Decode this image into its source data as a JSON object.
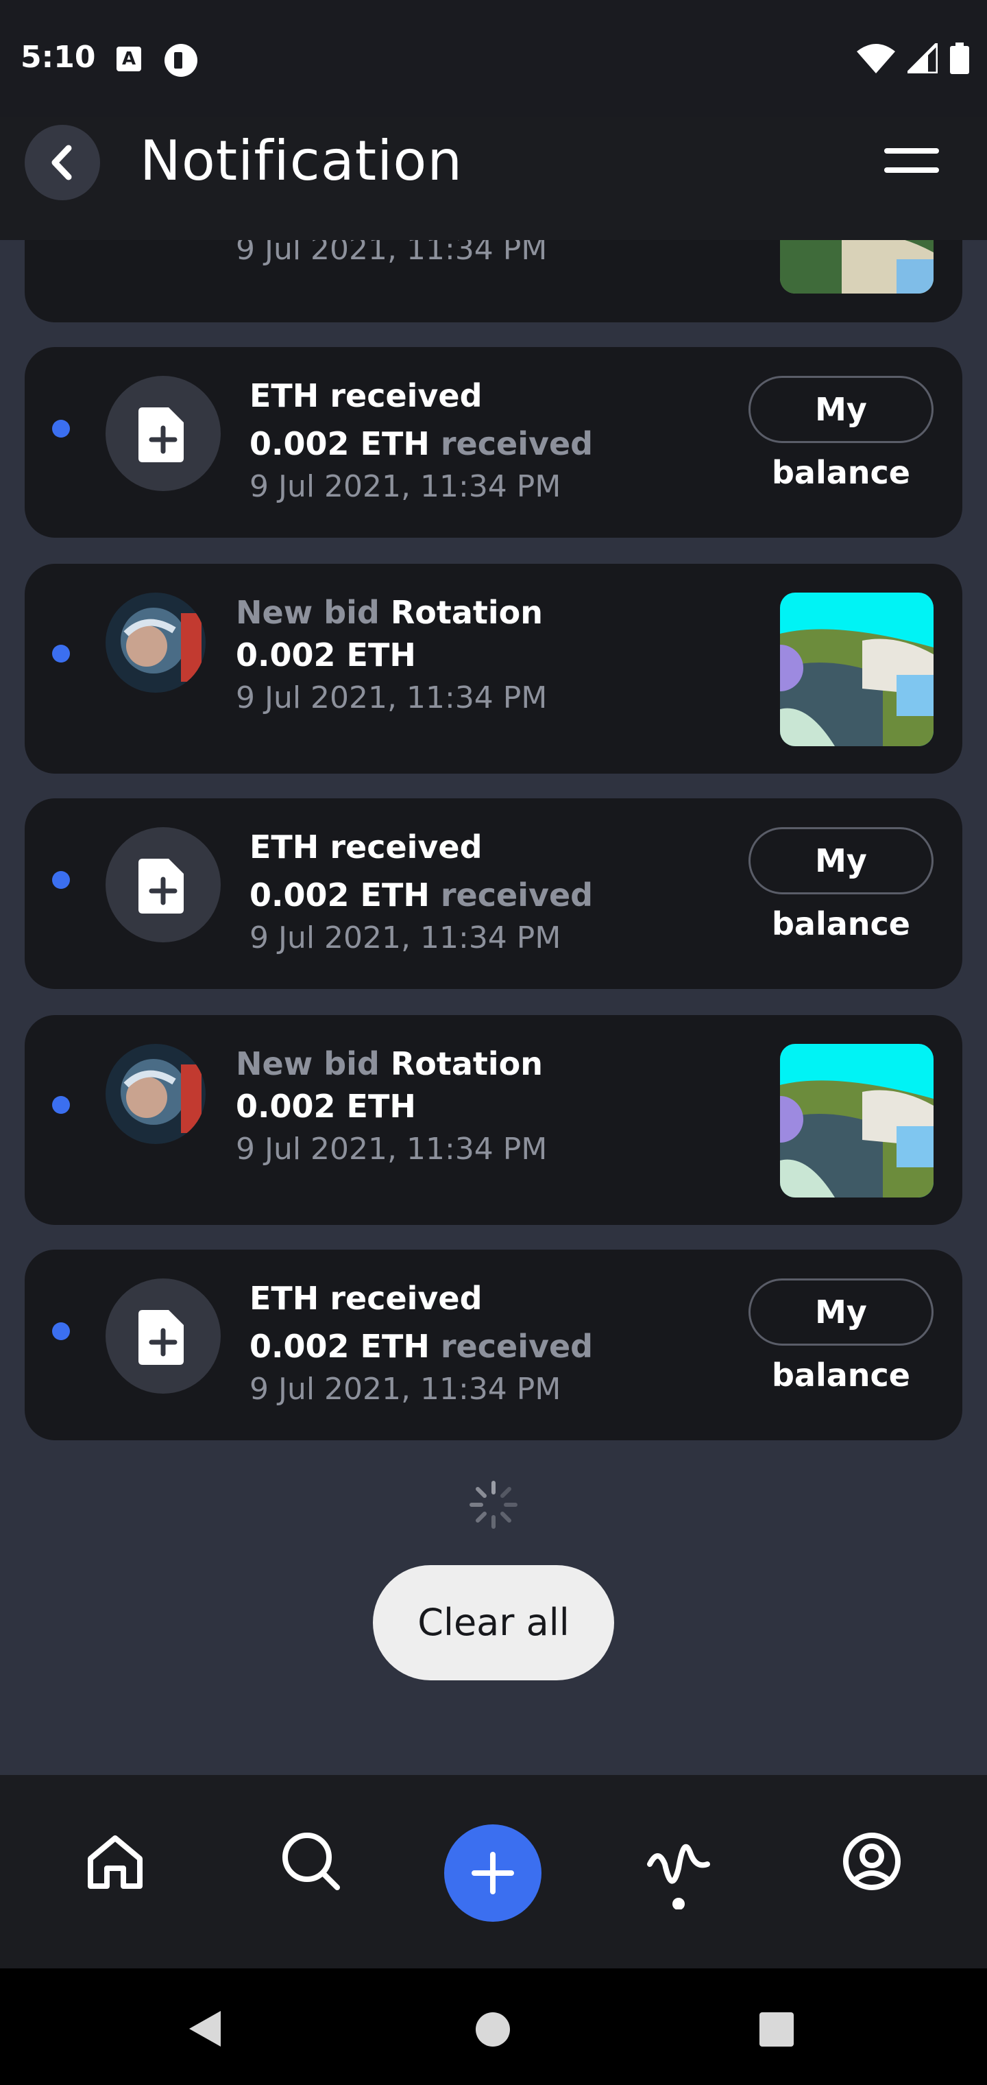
{
  "status": {
    "time": "5:10"
  },
  "header": {
    "title": "Notification"
  },
  "top_card": {
    "date": "9 Jul 2021, 11:34 PM"
  },
  "notifications": [
    {
      "type": "eth",
      "title": "ETH received",
      "amount": "0.002 ETH",
      "suffix": "received",
      "date": "9 Jul 2021, 11:34 PM",
      "action": "My balance"
    },
    {
      "type": "bid",
      "prefix": "New bid",
      "name": "Rotation",
      "amount": "0.002 ETH",
      "date": "9 Jul 2021, 11:34 PM"
    },
    {
      "type": "eth",
      "title": "ETH received",
      "amount": "0.002 ETH",
      "suffix": "received",
      "date": "9 Jul 2021, 11:34 PM",
      "action": "My balance"
    },
    {
      "type": "bid",
      "prefix": "New bid",
      "name": "Rotation",
      "amount": "0.002 ETH",
      "date": "9 Jul 2021, 11:34 PM"
    },
    {
      "type": "eth",
      "title": "ETH received",
      "amount": "0.002 ETH",
      "suffix": "received",
      "date": "9 Jul 2021, 11:34 PM",
      "action": "My balance"
    }
  ],
  "actions": {
    "clear_all": "Clear all"
  },
  "colors": {
    "accent": "#3b6ff0",
    "card": "#17181c",
    "background": "#2f3340"
  },
  "bottom_nav": [
    "home-icon",
    "search-icon",
    "add-icon",
    "activity-icon",
    "profile-icon"
  ]
}
